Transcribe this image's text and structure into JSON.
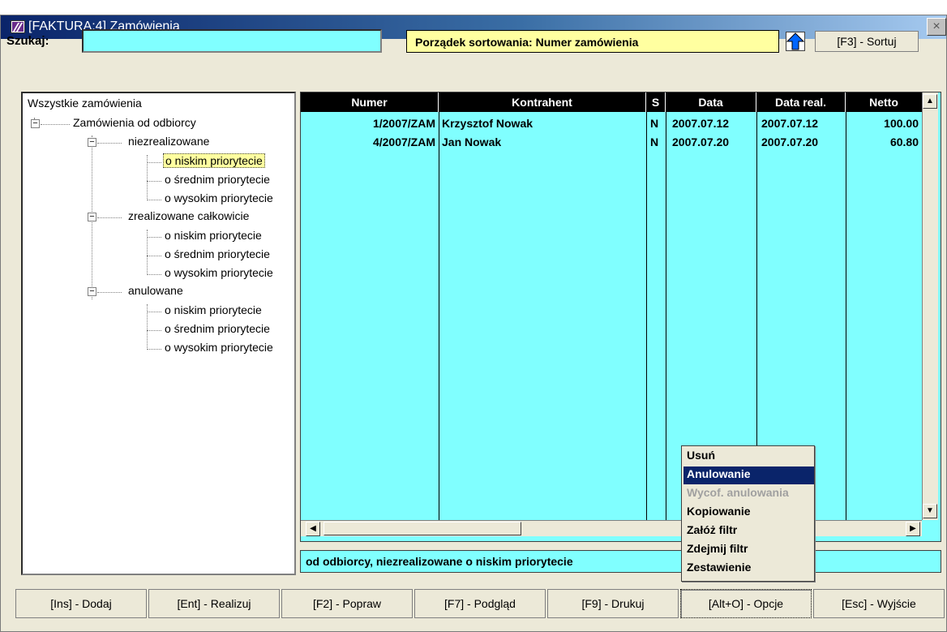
{
  "window": {
    "title": "[FAKTURA:4]  Zamówienia",
    "close_glyph": "×"
  },
  "search": {
    "label": "Szukaj:",
    "value": ""
  },
  "sort": {
    "label": "Porządek sortowania: Numer zamówienia",
    "direction": "ascending",
    "button_label": "[F3] - Sortuj"
  },
  "tree": {
    "root": "Wszystkie zamówienia",
    "group": "Zamówienia od odbiorcy",
    "categories": [
      {
        "label": "niezrealizowane",
        "children": [
          "o niskim priorytecie",
          "o średnim priorytecie",
          "o wysokim priorytecie"
        ]
      },
      {
        "label": "zrealizowane całkowicie",
        "children": [
          "o niskim priorytecie",
          "o średnim priorytecie",
          "o wysokim priorytecie"
        ]
      },
      {
        "label": "anulowane",
        "children": [
          "o niskim priorytecie",
          "o średnim priorytecie",
          "o wysokim priorytecie"
        ]
      }
    ],
    "selected": "o niskim priorytecie"
  },
  "table": {
    "columns": [
      "Numer",
      "Kontrahent",
      "S",
      "Data",
      "Data real.",
      "Netto"
    ],
    "rows": [
      [
        "1/2007/ZAM",
        "Krzysztof Nowak",
        "N",
        "2007.07.12",
        "2007.07.12",
        "100.00"
      ],
      [
        "4/2007/ZAM",
        "Jan Nowak",
        "N",
        "2007.07.20",
        "2007.07.20",
        "60.80"
      ]
    ]
  },
  "status": {
    "text": "od odbiorcy, niezrealizowane o niskim priorytecie"
  },
  "context_menu": {
    "items": [
      "Usuń",
      "Anulowanie",
      "Wycof. anulowania",
      "Kopiowanie",
      "Załóż filtr",
      "Zdejmij filtr",
      "Zestawienie"
    ],
    "active": "Anulowanie",
    "disabled": [
      "Wycof. anulowania"
    ]
  },
  "buttons": [
    "[Ins] - Dodaj",
    "[Ent] - Realizuj",
    "[F2] - Popraw",
    "[F7] - Podgląd",
    "[F9] - Drukuj",
    "[Alt+O] - Opcje",
    "[Esc] - Wyjście"
  ],
  "colors": {
    "cyan": "#80ffff",
    "yellow": "#ffffa0",
    "title_dark": "#0a246a",
    "menu_highlight": "#0a246a"
  },
  "icons": {
    "app": "faktura-app-icon",
    "sort_arrow": "arrow-up-icon",
    "scroll_up": "scroll-up-icon",
    "scroll_down": "scroll-down-icon",
    "scroll_left": "scroll-left-icon",
    "scroll_right": "scroll-right-icon",
    "tree_toggle": "tree-collapse-icon"
  }
}
